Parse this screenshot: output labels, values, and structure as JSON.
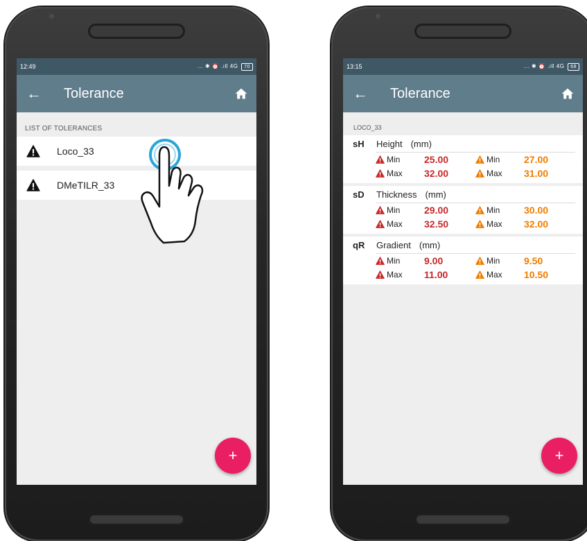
{
  "colors": {
    "statusbar": "#3f5866",
    "appbar": "#607d8b",
    "fab": "#e91e63",
    "danger": "#c62828",
    "warning": "#ef7c00"
  },
  "left_screen": {
    "status": {
      "time": "12:49",
      "icons": "... ✱ ⏰ .ıll 4G",
      "battery": "70"
    },
    "appbar": {
      "back_icon": "←",
      "title": "Tolerance",
      "home_icon": "home-icon"
    },
    "section_header": "LIST OF TOLERANCES",
    "items": [
      {
        "label": "Loco_33",
        "icon": "warning-icon"
      },
      {
        "label": "DMeTILR_33",
        "icon": "warning-icon"
      }
    ],
    "fab_label": "+"
  },
  "right_screen": {
    "status": {
      "time": "13:15",
      "icons": "... ✱ ⏰ .ıll 4G",
      "battery": "68"
    },
    "appbar": {
      "back_icon": "←",
      "title": "Tolerance",
      "home_icon": "home-icon"
    },
    "section_header": "LOCO_33",
    "groups": [
      {
        "code": "sH",
        "name": "Height",
        "unit": "(mm)",
        "rows": [
          {
            "danger_label": "Min",
            "danger_value": "25.00",
            "warn_label": "Min",
            "warn_value": "27.00"
          },
          {
            "danger_label": "Max",
            "danger_value": "32.00",
            "warn_label": "Max",
            "warn_value": "31.00"
          }
        ]
      },
      {
        "code": "sD",
        "name": "Thickness",
        "unit": "(mm)",
        "rows": [
          {
            "danger_label": "Min",
            "danger_value": "29.00",
            "warn_label": "Min",
            "warn_value": "30.00"
          },
          {
            "danger_label": "Max",
            "danger_value": "32.50",
            "warn_label": "Max",
            "warn_value": "32.00"
          }
        ]
      },
      {
        "code": "qR",
        "name": "Gradient",
        "unit": "(mm)",
        "rows": [
          {
            "danger_label": "Min",
            "danger_value": "9.00",
            "warn_label": "Min",
            "warn_value": "9.50"
          },
          {
            "danger_label": "Max",
            "danger_value": "11.00",
            "warn_label": "Max",
            "warn_value": "10.50"
          }
        ]
      }
    ],
    "fab_label": "+"
  }
}
